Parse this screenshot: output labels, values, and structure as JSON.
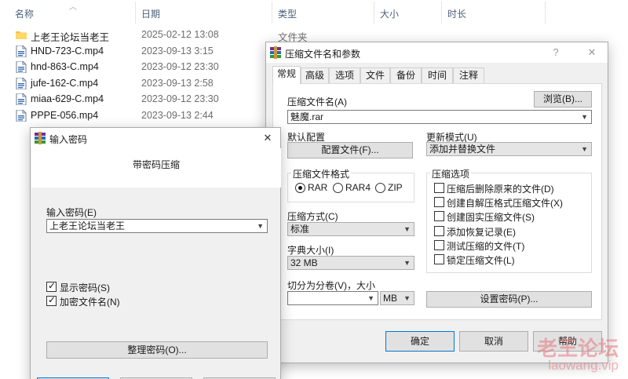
{
  "explorer": {
    "columns": [
      "名称",
      "日期",
      "类型",
      "大小",
      "时长"
    ],
    "files": [
      {
        "name": "上老王论坛当老王",
        "date": "2025-02-12 13:08",
        "type": "文件夹",
        "kind": "folder"
      },
      {
        "name": "HND-723-C.mp4",
        "date": "2023-09-13 3:15",
        "type": "",
        "kind": "file"
      },
      {
        "name": "hnd-863-C.mp4",
        "date": "2023-09-12 23:30",
        "type": "",
        "kind": "file"
      },
      {
        "name": "jufe-162-C.mp4",
        "date": "2023-09-13 2:58",
        "type": "",
        "kind": "file"
      },
      {
        "name": "miaa-629-C.mp4",
        "date": "2023-09-12 23:30",
        "type": "",
        "kind": "file"
      },
      {
        "name": "PPPE-056.mp4",
        "date": "2023-09-13 2:44",
        "type": "",
        "kind": "file"
      }
    ]
  },
  "archive_dialog": {
    "title": "压缩文件名和参数",
    "help": "?",
    "close": "✕",
    "tabs": [
      "常规",
      "高级",
      "选项",
      "文件",
      "备份",
      "时间",
      "注释"
    ],
    "archive_name_label": "压缩文件名(A)",
    "archive_name_value": "魅魔.rar",
    "browse_button": "浏览(B)...",
    "default_profile_label": "默认配置",
    "profiles_button": "配置文件(F)...",
    "update_mode_label": "更新模式(U)",
    "update_mode_value": "添加并替换文件",
    "format_group": "压缩文件格式",
    "formats": [
      {
        "label": "RAR",
        "selected": true
      },
      {
        "label": "RAR4",
        "selected": false
      },
      {
        "label": "ZIP",
        "selected": false
      }
    ],
    "method_label": "压缩方式(C)",
    "method_value": "标准",
    "dict_label": "字典大小(I)",
    "dict_value": "32 MB",
    "split_label": "切分为分卷(V)，大小",
    "split_value": "",
    "split_unit": "MB",
    "options_group": "压缩选项",
    "options": [
      {
        "label": "压缩后删除原来的文件(D)",
        "checked": false
      },
      {
        "label": "创建自解压格式压缩文件(X)",
        "checked": false
      },
      {
        "label": "创建固实压缩文件(S)",
        "checked": false
      },
      {
        "label": "添加恢复记录(E)",
        "checked": false
      },
      {
        "label": "测试压缩的文件(T)",
        "checked": false
      },
      {
        "label": "锁定压缩文件(L)",
        "checked": false
      }
    ],
    "set_password_button": "设置密码(P)...",
    "ok_button": "确定",
    "cancel_button": "取消",
    "help_button": "帮助"
  },
  "password_dialog": {
    "title": "输入密码",
    "close": "✕",
    "heading": "带密码压缩",
    "password_label": "输入密码(E)",
    "password_value": "上老王论坛当老王",
    "show_password": {
      "label": "显示密码(S)",
      "checked": true
    },
    "encrypt_names": {
      "label": "加密文件名(N)",
      "checked": true
    },
    "organize_button": "整理密码(O)..."
  },
  "watermark": {
    "line1": "老王论坛",
    "line2": "laowang.vip"
  },
  "colors": {
    "accent": "#0078d7",
    "dialog_bg": "#f0f0f0",
    "header_text": "#4c607a"
  }
}
